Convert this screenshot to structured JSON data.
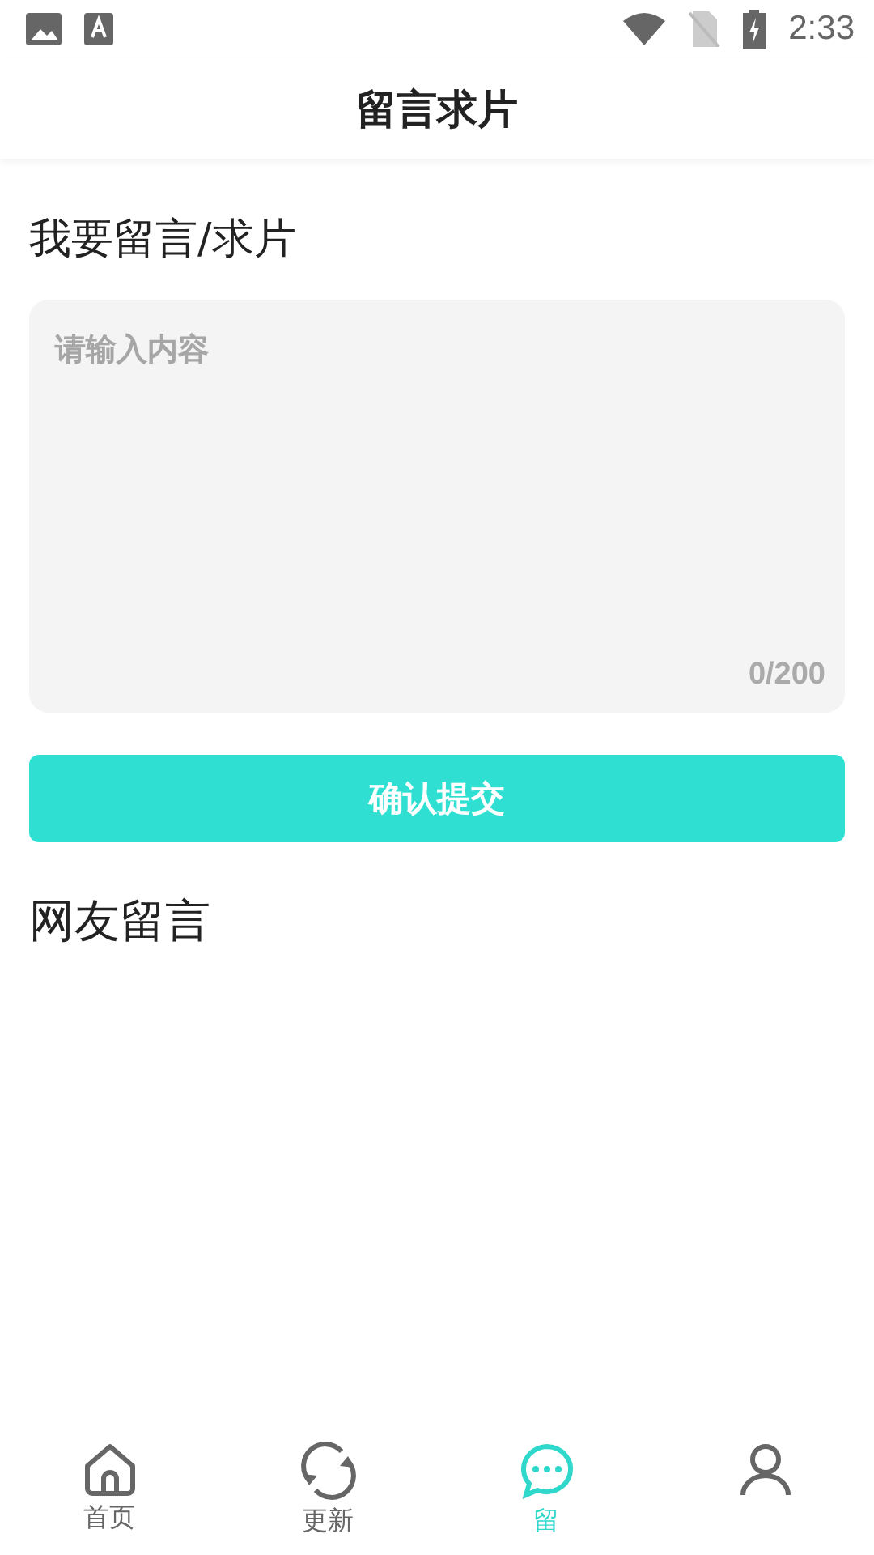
{
  "status_bar": {
    "time": "2:33"
  },
  "header": {
    "title": "留言求片"
  },
  "compose": {
    "heading": "我要留言/求片",
    "placeholder": "请输入内容",
    "counter": "0/200",
    "submit": "确认提交"
  },
  "comments": {
    "heading": "网友留言"
  },
  "tab_bar": [
    {
      "label": "首页",
      "selected": false
    },
    {
      "label": "更新",
      "selected": false
    },
    {
      "label": "留",
      "selected": true
    },
    {
      "selected": false
    }
  ]
}
